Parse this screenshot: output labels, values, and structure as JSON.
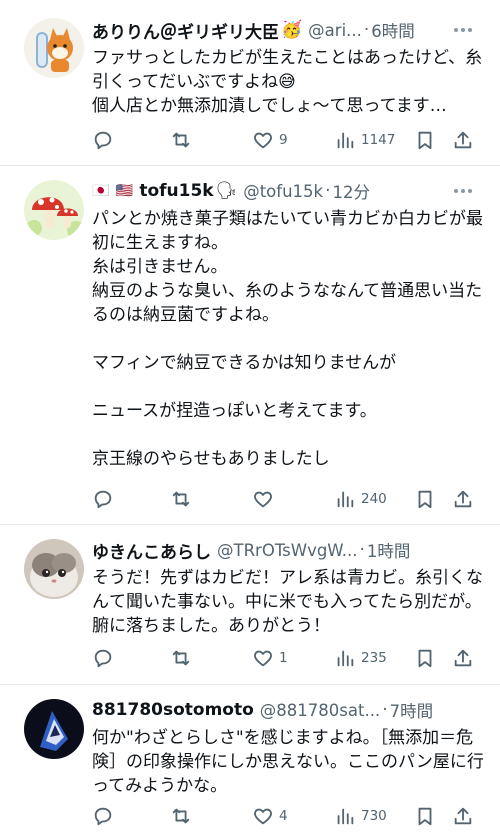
{
  "tweets": [
    {
      "name": "ありりん＠ギリギリ大臣",
      "emoji": "🥳",
      "handle": "@ari...",
      "sep": "·",
      "time": "6時間",
      "text": "ファサっとしたカビが生えたことはあったけど、糸引くってだいぶですよね😅\n個人店とか無添加漬しでしょ〜て思ってます…",
      "replies": "",
      "retweets": "",
      "likes": "9",
      "views": "1147"
    },
    {
      "flags": "🇯🇵 🇺🇸",
      "name": "tofu15k",
      "emoji": "🗣",
      "handle": "@tofu15k",
      "sep": "·",
      "time": "12分",
      "text": "パンとか焼き菓子類はたいてい青カビか白カビが最初に生えますね。\n糸は引きません。\n納豆のような臭い、糸のようななんて普通思い当たるのは納豆菌ですよね。\n\nマフィンで納豆できるかは知りませんが\n\nニュースが捏造っぽいと考えてます。\n\n京王線のやらせもありましたし",
      "replies": "",
      "retweets": "",
      "likes": "",
      "views": "240"
    },
    {
      "name": "ゆきんこあらし",
      "handle": "@TRrOTsWvgW...",
      "sep": "·",
      "time": "1時間",
      "text": "そうだ！先ずはカビだ！アレ系は青カビ。糸引くなんて聞いた事ない。中に米でも入ってたら別だが。腑に落ちました。ありがとう！",
      "replies": "",
      "retweets": "",
      "likes": "1",
      "views": "235"
    },
    {
      "name": "881780sotomoto",
      "handle": "@881780sat...",
      "sep": "·",
      "time": "7時間",
      "text": "何か\"わざとらしさ\"を感じますよね。［無添加＝危険］の印象操作にしか思えない。ここのパン屋に行ってみようかな。",
      "replies": "",
      "retweets": "",
      "likes": "4",
      "views": "730"
    }
  ],
  "icons": {
    "reply": "speech-bubble",
    "retweet": "repost-arrows",
    "like": "heart-outline",
    "views": "bar-chart",
    "bookmark": "bookmark",
    "share": "share-up-arrow",
    "more": "three-dots"
  },
  "colors": {
    "text": "#0f1419",
    "secondary": "#536471",
    "divider": "#e6e9ec"
  }
}
